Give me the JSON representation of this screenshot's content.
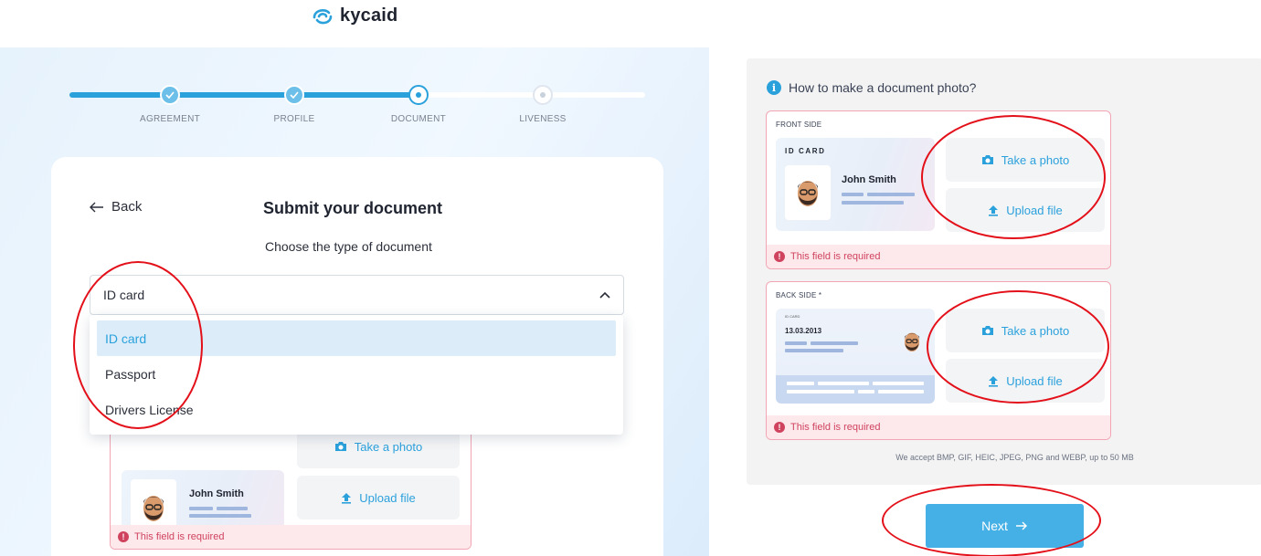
{
  "brand": {
    "name": "kycaid",
    "accent": "#2ba1dc"
  },
  "stepper": {
    "steps": [
      {
        "label": "AGREEMENT",
        "state": "done"
      },
      {
        "label": "PROFILE",
        "state": "done"
      },
      {
        "label": "DOCUMENT",
        "state": "current"
      },
      {
        "label": "LIVENESS",
        "state": "todo"
      }
    ]
  },
  "form": {
    "back_label": "Back",
    "title": "Submit your document",
    "subtitle": "Choose the type of document",
    "select_value": "ID card",
    "options": [
      "ID card",
      "Passport",
      "Drivers License"
    ],
    "selected_option": "ID card"
  },
  "doc_card": {
    "name": "John Smith",
    "id_card_label": "ID CARD",
    "take_photo": "Take a photo",
    "upload_file": "Upload file",
    "error": "This field is required"
  },
  "help": {
    "title": "How to make a document photo?",
    "front_label": "FRONT SIDE",
    "back_label": "BACK SIDE *",
    "back_date": "13.03.2013",
    "back_id_label": "ID CARD",
    "accept_note": "We accept BMP, GIF, HEIC, JPEG, PNG and WEBP, up to 50 MB"
  },
  "next_label": "Next"
}
